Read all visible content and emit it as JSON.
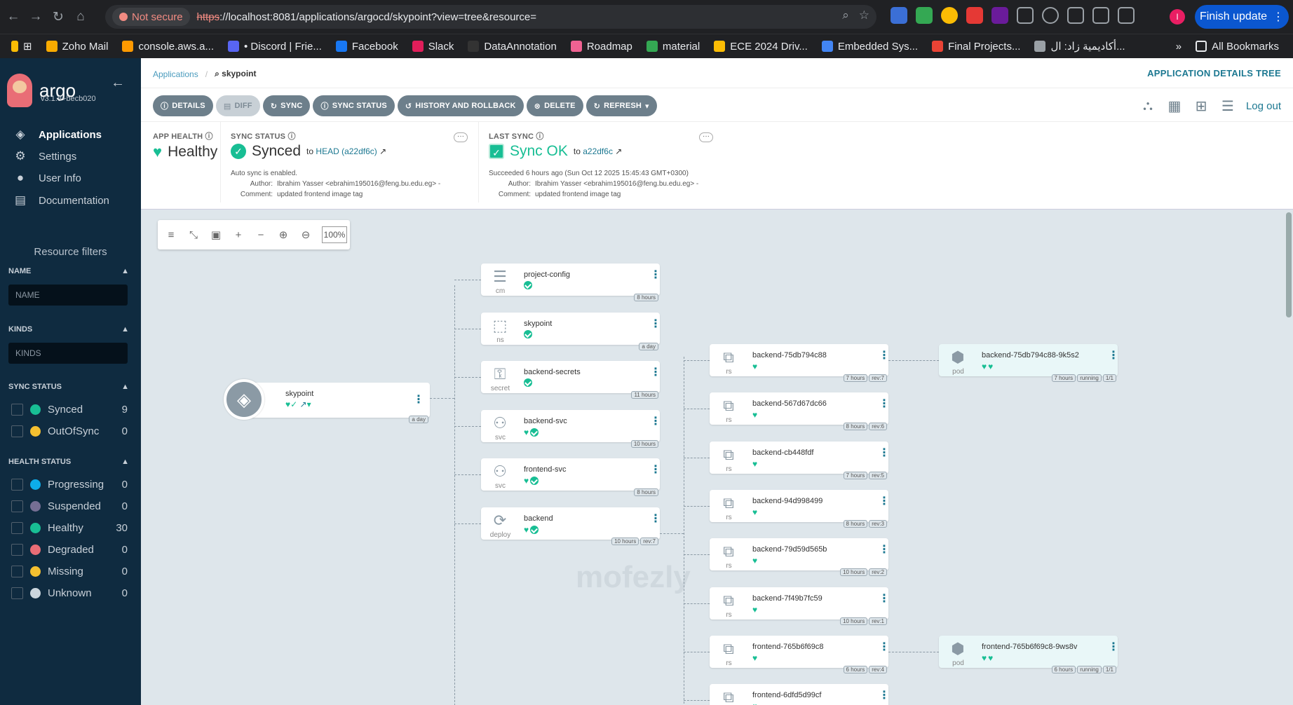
{
  "browser": {
    "not_secure": "Not secure",
    "url_scheme": "https",
    "url_rest": "://localhost:8081/applications/argocd/skypoint?view=tree&resource=",
    "finish_update": "Finish update",
    "profile_letter": "I",
    "bookmarks": [
      {
        "label": "Zoho Mail",
        "color": "#f9ab00"
      },
      {
        "label": "console.aws.a...",
        "color": "#ff9900"
      },
      {
        "label": "• Discord | Frie...",
        "color": "#5865f2"
      },
      {
        "label": "Facebook",
        "color": "#1877f2"
      },
      {
        "label": "Slack",
        "color": "#e01e5a"
      },
      {
        "label": "DataAnnotation",
        "color": "#333333"
      },
      {
        "label": "Roadmap",
        "color": "#f06292"
      },
      {
        "label": "material",
        "color": "#34a853"
      },
      {
        "label": "ECE 2024 Driv...",
        "color": "#fbbc04"
      },
      {
        "label": "Embedded Sys...",
        "color": "#4285f4"
      },
      {
        "label": "Final Projects...",
        "color": "#ea4335"
      },
      {
        "label": "أكاديمية زاد: ال...",
        "color": "#9aa0a6"
      }
    ],
    "more_bookmarks": "»",
    "all_bookmarks": "All Bookmarks"
  },
  "sidebar": {
    "logo": "argo",
    "version": "v3.1.8+becb020",
    "nav": [
      {
        "label": "Applications",
        "icon": "layers-icon"
      },
      {
        "label": "Settings",
        "icon": "gear-icon"
      },
      {
        "label": "User Info",
        "icon": "user-icon"
      },
      {
        "label": "Documentation",
        "icon": "book-icon"
      }
    ],
    "resource_filters": "Resource filters",
    "name_header": "NAME",
    "name_placeholder": "NAME",
    "kinds_header": "KINDS",
    "kinds_placeholder": "KINDS",
    "sync_status_header": "SYNC STATUS",
    "sync_items": [
      {
        "label": "Synced",
        "count": "9",
        "color": "#18be94"
      },
      {
        "label": "OutOfSync",
        "count": "0",
        "color": "#f4c030"
      }
    ],
    "health_status_header": "HEALTH STATUS",
    "health_items": [
      {
        "label": "Progressing",
        "count": "0",
        "color": "#0dadea"
      },
      {
        "label": "Suspended",
        "count": "0",
        "color": "#766f94"
      },
      {
        "label": "Healthy",
        "count": "30",
        "color": "#18be94"
      },
      {
        "label": "Degraded",
        "count": "0",
        "color": "#e96d76"
      },
      {
        "label": "Missing",
        "count": "0",
        "color": "#f4c030"
      },
      {
        "label": "Unknown",
        "count": "0",
        "color": "#ccd6dd"
      }
    ]
  },
  "main": {
    "breadcrumb_root": "Applications",
    "breadcrumb_current": "skypoint",
    "page_mode": "APPLICATION DETAILS TREE",
    "actions": [
      "DETAILS",
      "DIFF",
      "SYNC",
      "SYNC STATUS",
      "HISTORY AND ROLLBACK",
      "DELETE",
      "REFRESH"
    ],
    "logout": "Log out",
    "app_health_label": "APP HEALTH",
    "app_health_value": "Healthy",
    "sync_status_label": "SYNC STATUS",
    "sync_status_value": "Synced",
    "sync_to": "to",
    "sync_head": "HEAD (a22df6c)",
    "auto_sync": "Auto sync is enabled.",
    "author_key": "Author:",
    "author_value": "Ibrahim Yasser <ebrahim195016@feng.bu.edu.eg> -",
    "comment_key": "Comment:",
    "comment_value": "updated frontend image tag",
    "last_sync_label": "LAST SYNC",
    "last_sync_value": "Sync OK",
    "last_sync_to": "to",
    "last_sync_rev": "a22df6c",
    "succeeded": "Succeeded 6 hours ago (Sun Oct 12 2025 15:45:43 GMT+0300)",
    "zoom": "100%"
  },
  "tree": {
    "app": {
      "name": "skypoint",
      "age": "a day"
    },
    "level1": [
      {
        "name": "project-config",
        "kind": "cm",
        "tags": [
          "8 hours"
        ],
        "status": "sync"
      },
      {
        "name": "skypoint",
        "kind": "ns",
        "tags": [
          "a day"
        ],
        "status": "sync"
      },
      {
        "name": "backend-secrets",
        "kind": "secret",
        "tags": [
          "11 hours"
        ],
        "status": "sync"
      },
      {
        "name": "backend-svc",
        "kind": "svc",
        "tags": [
          "10 hours"
        ],
        "status": "both"
      },
      {
        "name": "frontend-svc",
        "kind": "svc",
        "tags": [
          "8 hours"
        ],
        "status": "both"
      },
      {
        "name": "backend",
        "kind": "deploy",
        "tags": [
          "10 hours",
          "rev:7"
        ],
        "status": "both"
      }
    ],
    "level2": [
      {
        "name": "backend-75db794c88",
        "kind": "rs",
        "tags": [
          "7 hours",
          "rev:7"
        ]
      },
      {
        "name": "backend-567d67dc66",
        "kind": "rs",
        "tags": [
          "8 hours",
          "rev:6"
        ]
      },
      {
        "name": "backend-cb448fdf",
        "kind": "rs",
        "tags": [
          "7 hours",
          "rev:5"
        ]
      },
      {
        "name": "backend-94d998499",
        "kind": "rs",
        "tags": [
          "8 hours",
          "rev:3"
        ]
      },
      {
        "name": "backend-79d59d565b",
        "kind": "rs",
        "tags": [
          "10 hours",
          "rev:2"
        ]
      },
      {
        "name": "backend-7f49b7fc59",
        "kind": "rs",
        "tags": [
          "10 hours",
          "rev:1"
        ]
      },
      {
        "name": "frontend-765b6f69c8",
        "kind": "rs",
        "tags": [
          "6 hours",
          "rev:4"
        ]
      },
      {
        "name": "frontend-6dfd5d99cf",
        "kind": "rs",
        "tags": []
      }
    ],
    "pods": [
      {
        "name": "backend-75db794c88-9k5s2",
        "kind": "pod",
        "tags": [
          "7 hours",
          "running",
          "1/1"
        ]
      },
      {
        "name": "frontend-765b6f69c8-9ws8v",
        "kind": "pod",
        "tags": [
          "6 hours",
          "running",
          "1/1"
        ]
      }
    ]
  },
  "colors": {
    "healthy": "#18be94",
    "sidebar": "#0f2b40",
    "accent": "#1c7891"
  }
}
